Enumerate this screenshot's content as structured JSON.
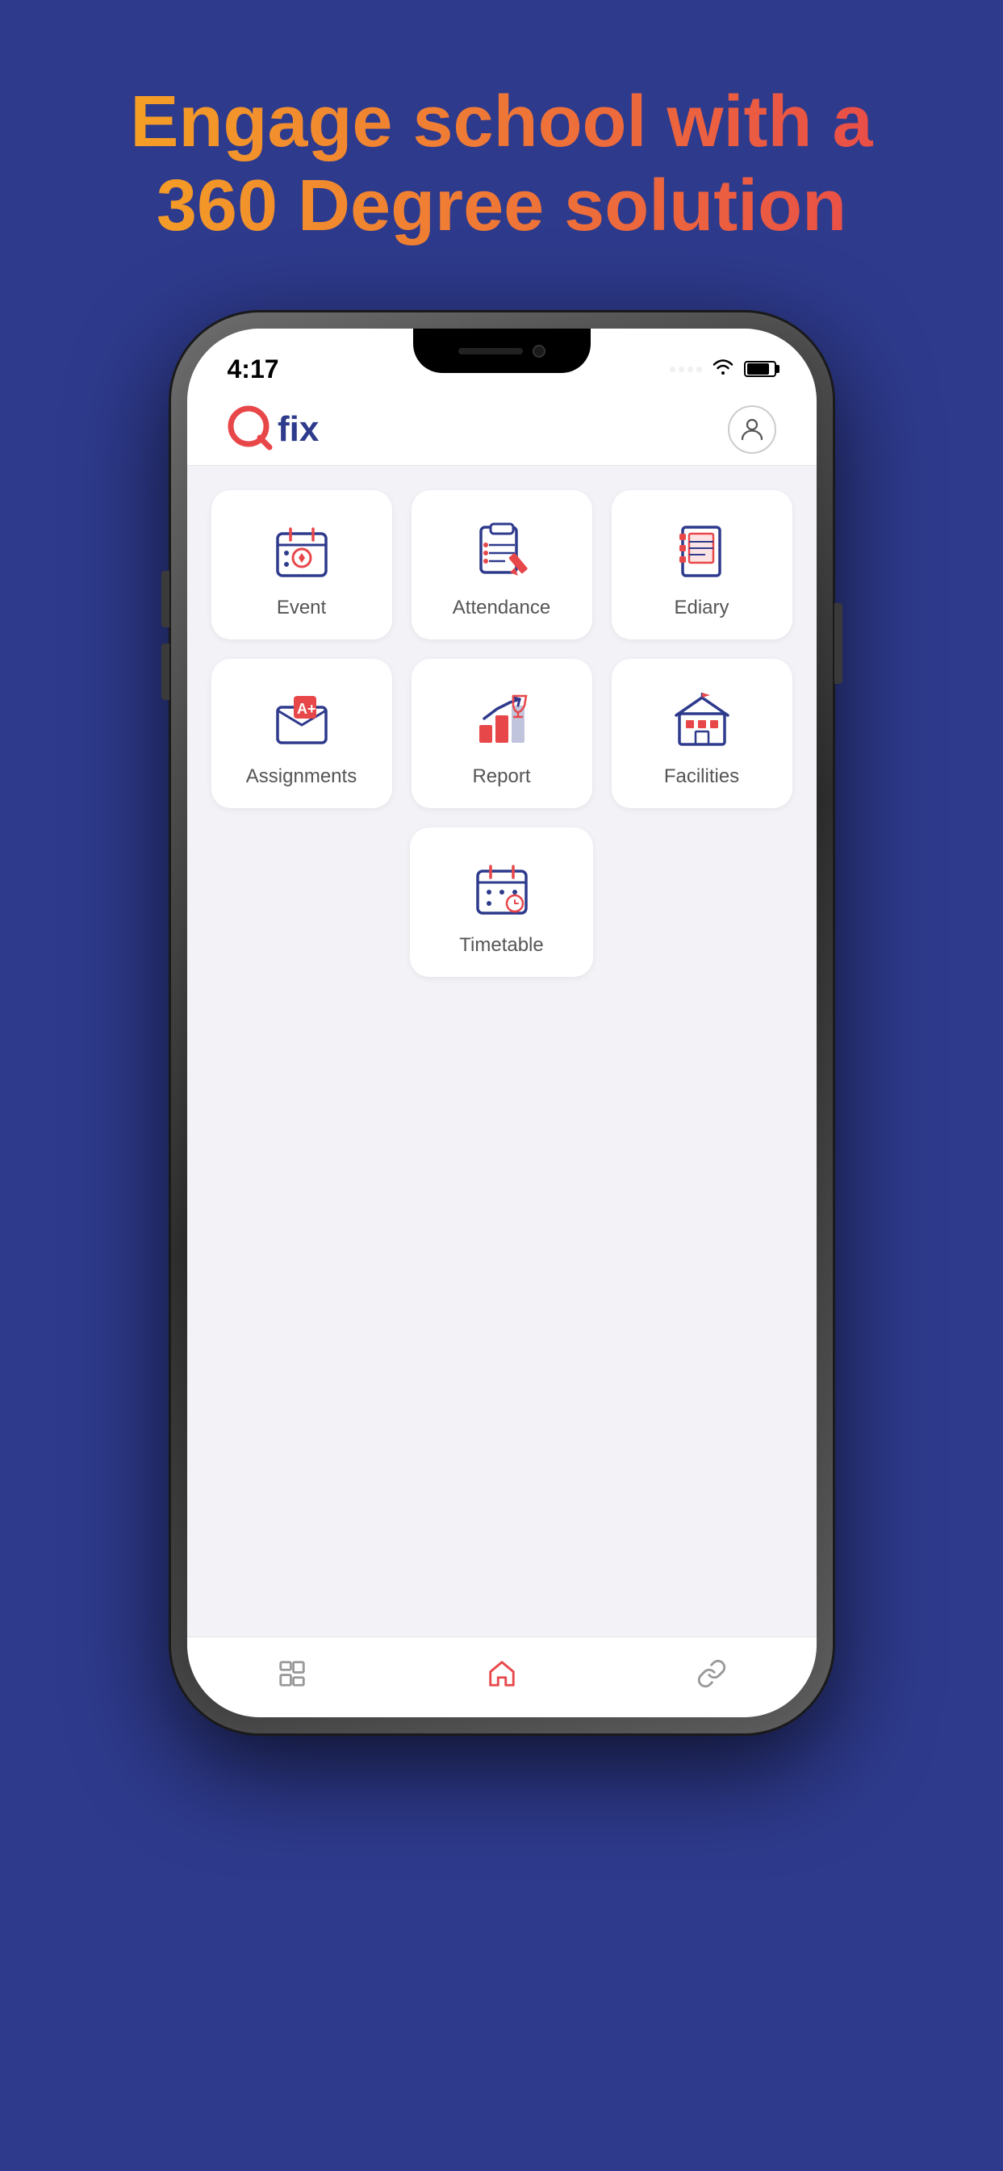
{
  "page": {
    "bg_color": "#2e3a8c"
  },
  "headline": {
    "line1": "Engage school with a",
    "line2": "360 Degree solution"
  },
  "status_bar": {
    "time": "4:17"
  },
  "header": {
    "logo_text": "fix",
    "profile_label": "User Profile"
  },
  "menu_items": [
    {
      "id": "event",
      "label": "Event",
      "icon": "event-icon"
    },
    {
      "id": "attendance",
      "label": "Attendance",
      "icon": "attendance-icon"
    },
    {
      "id": "ediary",
      "label": "Ediary",
      "icon": "ediary-icon"
    },
    {
      "id": "assignments",
      "label": "Assignments",
      "icon": "assignments-icon"
    },
    {
      "id": "report",
      "label": "Report",
      "icon": "report-icon"
    },
    {
      "id": "facilities",
      "label": "Facilities",
      "icon": "facilities-icon"
    },
    {
      "id": "timetable",
      "label": "Timetable",
      "icon": "timetable-icon"
    }
  ],
  "bottom_nav": [
    {
      "id": "dashboard",
      "label": "Dashboard",
      "active": false
    },
    {
      "id": "home",
      "label": "Home",
      "active": true
    },
    {
      "id": "links",
      "label": "Links",
      "active": false
    }
  ],
  "colors": {
    "primary": "#2e3a8c",
    "accent": "#e8474a",
    "orange": "#f5a623"
  }
}
